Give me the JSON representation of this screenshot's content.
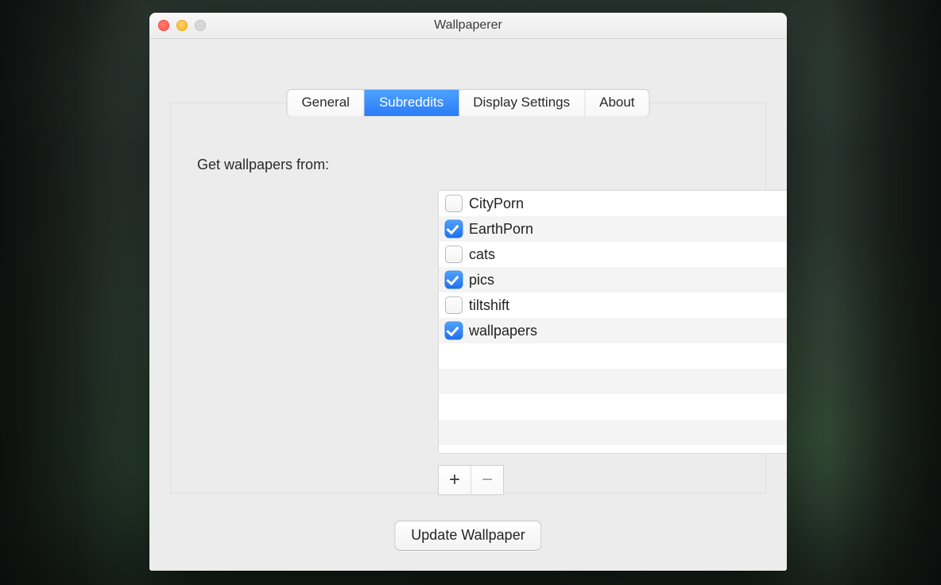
{
  "window": {
    "title": "Wallpaperer"
  },
  "tabs": {
    "items": [
      {
        "label": "General",
        "active": false
      },
      {
        "label": "Subreddits",
        "active": true
      },
      {
        "label": "Display Settings",
        "active": false
      },
      {
        "label": "About",
        "active": false
      }
    ]
  },
  "content": {
    "heading": "Get wallpapers from:",
    "subreddits": [
      {
        "name": "CityPorn",
        "checked": false
      },
      {
        "name": "EarthPorn",
        "checked": true
      },
      {
        "name": "cats",
        "checked": false
      },
      {
        "name": "pics",
        "checked": true
      },
      {
        "name": "tiltshift",
        "checked": false
      },
      {
        "name": "wallpapers",
        "checked": true
      }
    ],
    "empty_rows": 4,
    "buttons": {
      "add_label": "+",
      "remove_label": "−",
      "update_label": "Update Wallpaper"
    }
  }
}
